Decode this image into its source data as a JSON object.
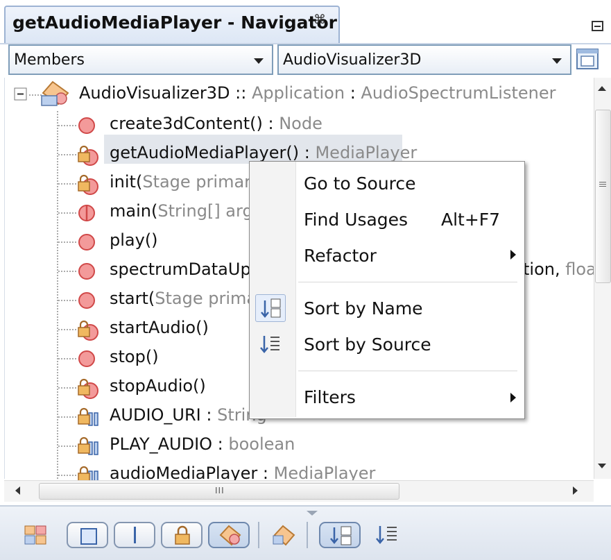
{
  "window": {
    "tab_title": "getAudioMediaPlayer - Navigator",
    "tab_close_glyph": "⌘"
  },
  "filters": {
    "view_combo": "Members",
    "class_combo": "AudioVisualizer3D"
  },
  "tree": {
    "root": {
      "name": "AudioVisualizer3D",
      "sep": " :: ",
      "type": "Application",
      "sep2": " : ",
      "interface": "AudioSpectrumListener"
    },
    "items": [
      {
        "name": "create3dContent()",
        "sep": " : ",
        "type": "Node",
        "icon": "public-method-icon"
      },
      {
        "name": "getAudioMediaPlayer()",
        "sep": " : ",
        "type": "MediaPlayer",
        "icon": "private-method-icon"
      },
      {
        "name": "init(",
        "param": "Stage primary",
        "icon": "private-method-icon"
      },
      {
        "name": "main(",
        "param": "String[] args",
        "icon": "static-method-icon"
      },
      {
        "name": "play()",
        "icon": "public-method-icon"
      },
      {
        "name": "spectrumDataUpd",
        "tail": "tion, ",
        "tail_gray": "floa",
        "icon": "public-method-icon"
      },
      {
        "name": "start(",
        "param": "Stage prima",
        "icon": "public-method-icon"
      },
      {
        "name": "startAudio()",
        "icon": "private-method-icon"
      },
      {
        "name": "stop()",
        "icon": "public-method-icon"
      },
      {
        "name": "stopAudio()",
        "icon": "private-method-icon"
      },
      {
        "name": "AUDIO_URI",
        "sep": " : ",
        "type": "String",
        "icon": "private-field-icon"
      },
      {
        "name": "PLAY_AUDIO",
        "sep": " : ",
        "type": "boolean",
        "icon": "private-field-icon"
      },
      {
        "name": "audioMediaPlayer",
        "sep": " : ",
        "type": "MediaPlayer",
        "icon": "private-field-icon"
      }
    ]
  },
  "scrollbar": {
    "grip": "III"
  },
  "context_menu": {
    "go_to_source": "Go to Source",
    "find_usages": "Find Usages",
    "find_usages_shortcut": "Alt+F7",
    "refactor": "Refactor",
    "sort_by_name": "Sort by Name",
    "sort_by_source": "Sort by Source",
    "filters": "Filters"
  },
  "colors": {
    "accent_border": "#9db3d3",
    "public_method": "#e04848",
    "private_lock": "#e0a64a",
    "gray_text": "#8a8a8a"
  }
}
